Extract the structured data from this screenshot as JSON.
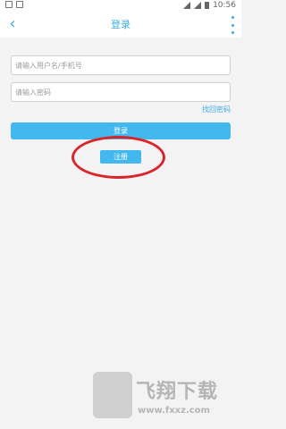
{
  "status_bar": {
    "time": "10:56"
  },
  "header": {
    "title": "登录"
  },
  "form": {
    "username_placeholder": "请输入用户名/手机号",
    "password_placeholder": "请输入密码",
    "forgot_password": "找回密码",
    "login_button": "登录",
    "register_button": "注册"
  },
  "watermark": {
    "brand": "飞翔下载",
    "url": "www.fxxz.com"
  },
  "colors": {
    "accent": "#43b8ee",
    "highlight_circle": "#d9252a"
  }
}
